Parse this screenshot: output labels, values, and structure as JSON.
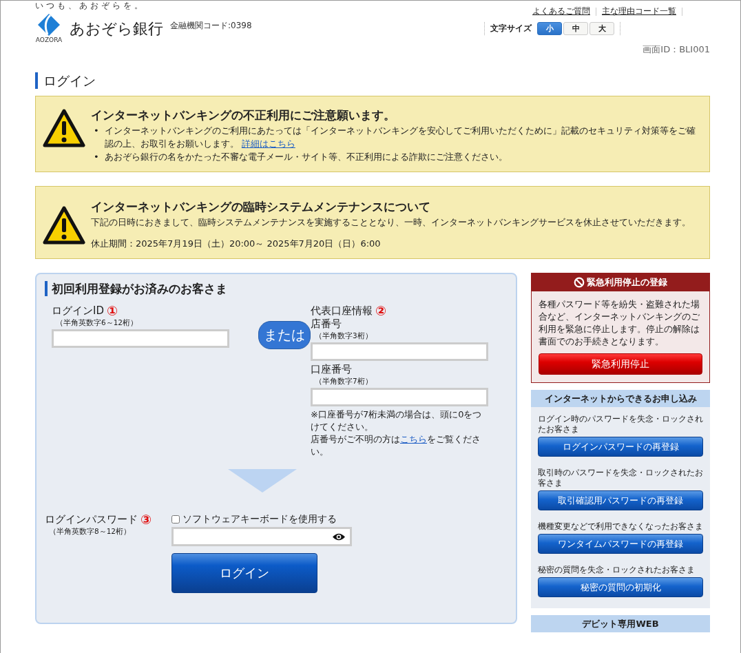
{
  "header": {
    "tagline": "いつも、あおぞらを。",
    "logo_text": "あおぞら銀行",
    "logo_sub": "AOZORA",
    "bank_code": "金融機関コード:0398",
    "links": [
      "よくあるご質問",
      "主な理由コード一覧"
    ],
    "font_size": {
      "label": "文字サイズ",
      "options": [
        {
          "label": "小",
          "selected": true
        },
        {
          "label": "中",
          "selected": false
        },
        {
          "label": "大",
          "selected": false
        }
      ]
    },
    "screen_id": "画面ID：BLI001"
  },
  "page_title": "ログイン",
  "notices": [
    {
      "kind": "bullets",
      "title": "インターネットバンキングの不正利用にご注意願います。",
      "items": [
        {
          "marker": "•",
          "text": "インターネットバンキングのご利用にあたっては「インターネットバンキングを安心してご利用いただくために」記載のセキュリティ対策等をご確認の上、お取引をお願いします。",
          "link": "詳細はこちら"
        },
        {
          "marker": "•",
          "text": "あおぞら銀行の名をかたった不審な電子メール・サイト等、不正利用による詐欺にご注意ください。"
        }
      ]
    },
    {
      "kind": "text",
      "title": "インターネットバンキングの臨時システムメンテナンスについて",
      "items": [
        {
          "text": "下記の日時におきまして、臨時システムメンテナンスを実施することとなり、一時、インターネットバンキングサービスを休止させていただきます。"
        },
        {
          "text": "休止期間：2025年7月19日（土）20:00～ 2025年7月20日（日）6:00"
        }
      ]
    }
  ],
  "login_panel": {
    "title": "初回利用登録がお済みのお客さま",
    "login_id": {
      "label": "ログインID",
      "badge": "①",
      "hint": "（半角英数字6～12桁）"
    },
    "or": "または",
    "account": {
      "label": "代表口座情報",
      "badge": "②",
      "fields": [
        {
          "label": "店番号",
          "hint": "（半角数字3桁）"
        },
        {
          "label": "口座番号",
          "hint": "（半角数字7桁）"
        }
      ],
      "note": "※口座番号が7桁未満の場合は、頭に0をつけてください。",
      "help": {
        "before": "店番号がご不明の方は",
        "link": "こちら",
        "after": "をご覧ください。"
      }
    },
    "password": {
      "label": "ログインパスワード",
      "badge": "③",
      "hint": "（半角英数字8～12桁）",
      "software_keyboard": {
        "label": "ソフトウェアキーボードを使用する",
        "checked": false
      }
    },
    "login_button": "ログイン"
  },
  "sidebar": {
    "emergency": {
      "title": "緊急利用停止の登録",
      "text": "各種パスワード等を紛失・盗難された場合など、インターネットバンキングのご利用を緊急に停止します。停止の解除は書面でのお手続きとなります。",
      "button": "緊急利用停止"
    },
    "apply": {
      "title": "インターネットからできるお申し込み",
      "items": [
        {
          "caption": "ログイン時のパスワードを失念・ロックされたお客さま",
          "button": "ログインパスワードの再登録"
        },
        {
          "caption": "取引時のパスワードを失念・ロックされたお客さま",
          "button": "取引確認用パスワードの再登録"
        },
        {
          "caption": "機種変更などで利用できなくなったお客さま",
          "button": "ワンタイムパスワードの再登録"
        },
        {
          "caption": "秘密の質問を失念・ロックされたお客さま",
          "button": "秘密の質問の初期化"
        }
      ]
    },
    "debit": {
      "title": "デビット専用WEB"
    }
  }
}
